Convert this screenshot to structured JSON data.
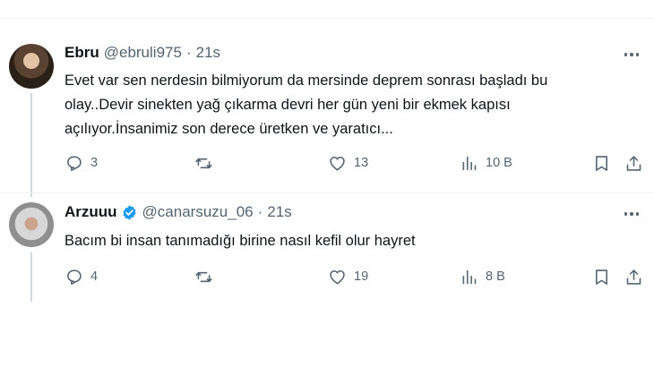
{
  "tweets": [
    {
      "name": "Ebru",
      "handle": "@ebruli975",
      "separator": "·",
      "time": "21s",
      "verified": false,
      "lines": [
        "Evet var sen nerdesin bilmiyorum da mersinde deprem sonrası başladı bu",
        "olay..Devir sinekten yağ çıkarma devri her gün yeni bir ekmek kapısı",
        "açılıyor.İnsanimiz son derece üretken ve yaratıcı..."
      ],
      "replies": "3",
      "reposts": "",
      "likes": "13",
      "views": "10 B"
    },
    {
      "name": "Arzuuu",
      "handle": "@canarsuzu_06",
      "separator": "·",
      "time": "21s",
      "verified": true,
      "lines": [
        "Bacım bi insan tanımadığı birine nasıl kefil olur hayret"
      ],
      "replies": "4",
      "reposts": "",
      "likes": "19",
      "views": "8 B"
    }
  ],
  "icons": {
    "reply": "reply-icon",
    "repost": "repost-icon",
    "like": "heart-icon",
    "views": "views-chart-icon",
    "bookmark": "bookmark-icon",
    "share": "share-icon",
    "more": "more-dots-icon",
    "verified": "verified-badge-icon"
  },
  "colors": {
    "text": "#0f1419",
    "secondary": "#536471",
    "verified": "#1d9bf0",
    "rule": "#eff3f4"
  }
}
